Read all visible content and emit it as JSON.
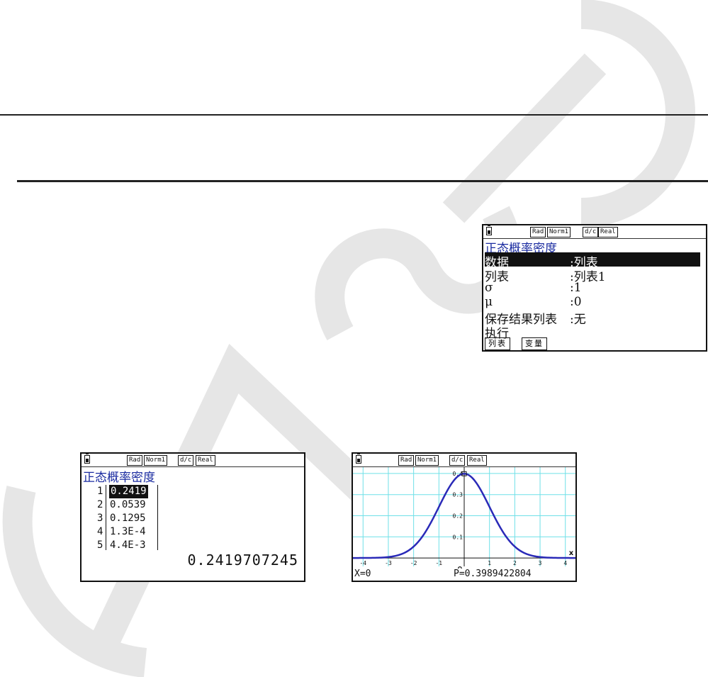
{
  "watermark": {
    "text": "CASIO",
    "color": "#e6e6e6"
  },
  "status": {
    "rad": "Rad",
    "norm": "Norm1",
    "dc": "d/c",
    "real": "Real"
  },
  "screen1": {
    "title": "正态概率密度",
    "rows": [
      {
        "label": "数据",
        "value": ":列表",
        "selected": true
      },
      {
        "label": "列表",
        "value": ":列表1"
      },
      {
        "label": "σ",
        "value": ":1"
      },
      {
        "label": "μ",
        "value": ":0"
      },
      {
        "label": "保存结果列表",
        "value": ":无"
      },
      {
        "label": "执行",
        "value": ""
      }
    ],
    "fkeys": [
      "列表",
      "变量"
    ]
  },
  "screen2": {
    "title": "正态概率密度",
    "list": [
      {
        "index": "1",
        "value": "0.2419"
      },
      {
        "index": "2",
        "value": "0.0539"
      },
      {
        "index": "3",
        "value": "0.1295"
      },
      {
        "index": "4",
        "value": "1.3E-4"
      },
      {
        "index": "5",
        "value": "4.4E-3"
      }
    ],
    "result": "0.2419707245"
  },
  "screen3": {
    "x_readout": "X=0",
    "p_readout": "P=0.3989422804",
    "x_axis_label": "x",
    "origin_label": "O",
    "colors": {
      "grid": "#6fe0e8",
      "curve": "#2a2ab8"
    },
    "chart_data": {
      "type": "line",
      "title": "",
      "xlabel": "x",
      "ylabel": "",
      "xlim": [
        -4.4,
        4.4
      ],
      "ylim": [
        -0.04,
        0.43
      ],
      "xticks": [
        -4,
        -3,
        -2,
        -1,
        1,
        2,
        3,
        4
      ],
      "yticks": [
        0.1,
        0.2,
        0.3,
        0.4
      ],
      "grid": true,
      "series": [
        {
          "mu": 0,
          "sigma": 1,
          "x": [
            -4.4,
            -4,
            -3.5,
            -3,
            -2.5,
            -2,
            -1.5,
            -1,
            -0.5,
            0,
            0.5,
            1,
            1.5,
            2,
            2.5,
            3,
            3.5,
            4,
            4.4
          ],
          "y": [
            0.0,
            0.0001,
            0.0009,
            0.0044,
            0.0175,
            0.054,
            0.1295,
            0.242,
            0.3521,
            0.3989,
            0.3521,
            0.242,
            0.1295,
            0.054,
            0.0175,
            0.0044,
            0.0009,
            0.0001,
            0.0
          ]
        }
      ]
    }
  }
}
